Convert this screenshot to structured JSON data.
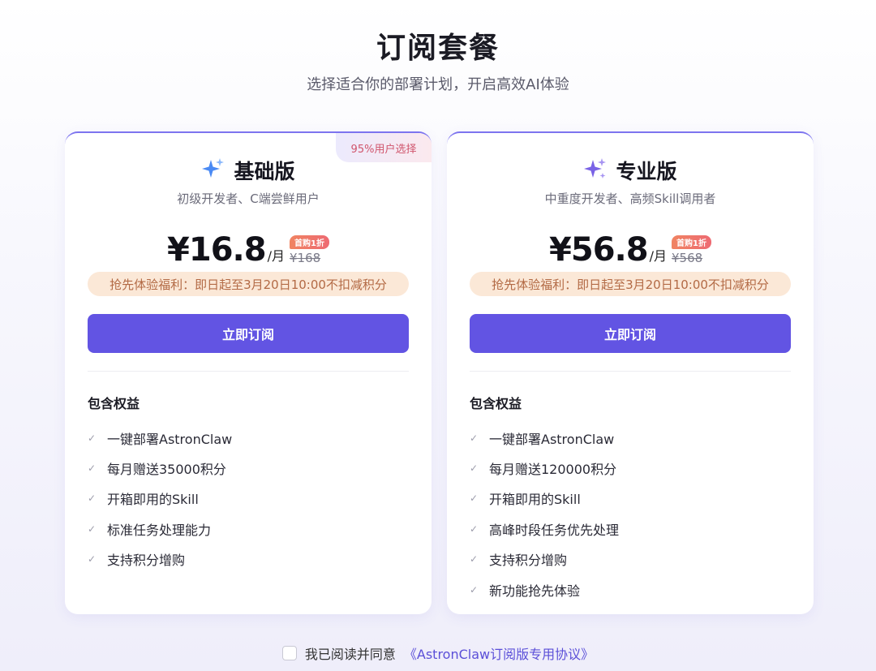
{
  "header": {
    "title": "订阅套餐",
    "subtitle": "选择适合你的部署计划，开启高效AI体验"
  },
  "plans": [
    {
      "corner_badge": "95%用户选择",
      "name": "基础版",
      "icon": "sparkle-icon",
      "icon_color": "#4a8af4",
      "description": "初级开发者、C端尝鲜用户",
      "price": "¥16.8",
      "unit": "/月",
      "discount_badge": "首购1折",
      "original_price": "¥168",
      "benefit": "抢先体验福利：即日起至3月20日10:00不扣减积分",
      "button": "立即订阅",
      "rights_title": "包含权益",
      "rights": [
        "一键部署AstronClaw",
        "每月赠送35000积分",
        "开箱即用的Skill",
        "标准任务处理能力",
        "支持积分增购"
      ]
    },
    {
      "name": "专业版",
      "icon": "sparkle-icon",
      "icon_color": "#7a63e6",
      "description": "中重度开发者、高频Skill调用者",
      "price": "¥56.8",
      "unit": "/月",
      "discount_badge": "首购1折",
      "original_price": "¥568",
      "benefit": "抢先体验福利：即日起至3月20日10:00不扣减积分",
      "button": "立即订阅",
      "rights_title": "包含权益",
      "rights": [
        "一键部署AstronClaw",
        "每月赠送120000积分",
        "开箱即用的Skill",
        "高峰时段任务优先处理",
        "支持积分增购",
        "新功能抢先体验"
      ]
    }
  ],
  "agreement": {
    "text": "我已阅读并同意",
    "link": "《AstronClaw订阅版专用协议》"
  },
  "colors": {
    "accent": "#6254e3",
    "benefit_bg": "#fbe8d7",
    "benefit_text": "#b36a45"
  }
}
